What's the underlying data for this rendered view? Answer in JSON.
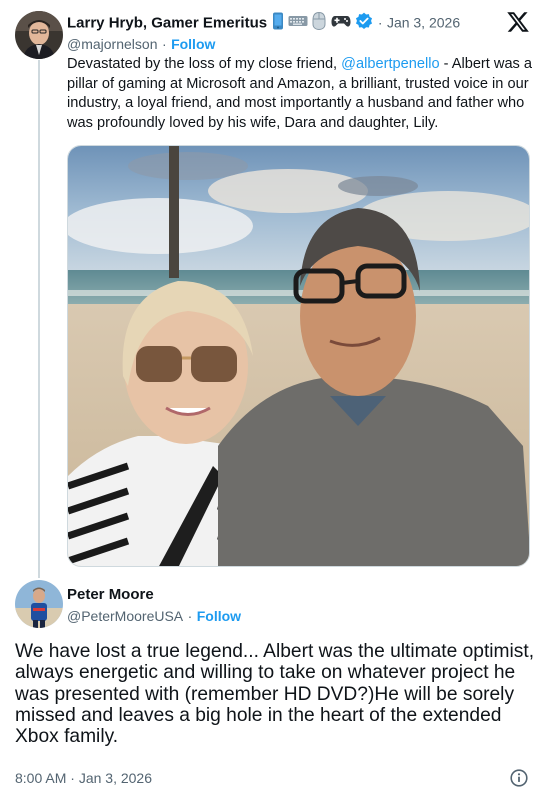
{
  "tweet1": {
    "author_name": "Larry Hryb, Gamer Emeritus",
    "name_emojis": [
      "phone-icon",
      "keyboard-icon",
      "mouse-icon",
      "gamepad-icon"
    ],
    "verified": true,
    "date_separator": "·",
    "date": "Jan 3, 2026",
    "handle": "@majornelson",
    "follow_separator": "·",
    "follow_label": "Follow",
    "text_before": "Devastated by the loss of my close friend, ",
    "mention": "@albertpenello",
    "text_after": " - Albert was a pillar of gaming at Microsoft and Amazon, a brilliant, trusted voice in our industry, a loyal friend, and most importantly a husband and father who was profoundly loved by his wife, Dara and daughter, Lily.",
    "photo_icon": "beach-selfie-photo"
  },
  "tweet2": {
    "author_name": "Peter Moore",
    "handle": "@PeterMooreUSA",
    "follow_separator": "·",
    "follow_label": "Follow",
    "text": "We have lost a true legend... Albert was the ultimate optimist, always energetic and willing to take on whatever project he was presented with (remember HD DVD?)He will be sorely missed and leaves a big hole in the heart of the extended Xbox family.",
    "time": "8:00 AM",
    "time_separator": "·",
    "date": "Jan 3, 2026"
  },
  "icons": {
    "platform_logo": "x-logo-icon",
    "info": "info-icon"
  },
  "colors": {
    "link": "#1d9bf0",
    "text": "#0f1419",
    "secondary": "#536471",
    "thread_line": "#cfd9de"
  }
}
